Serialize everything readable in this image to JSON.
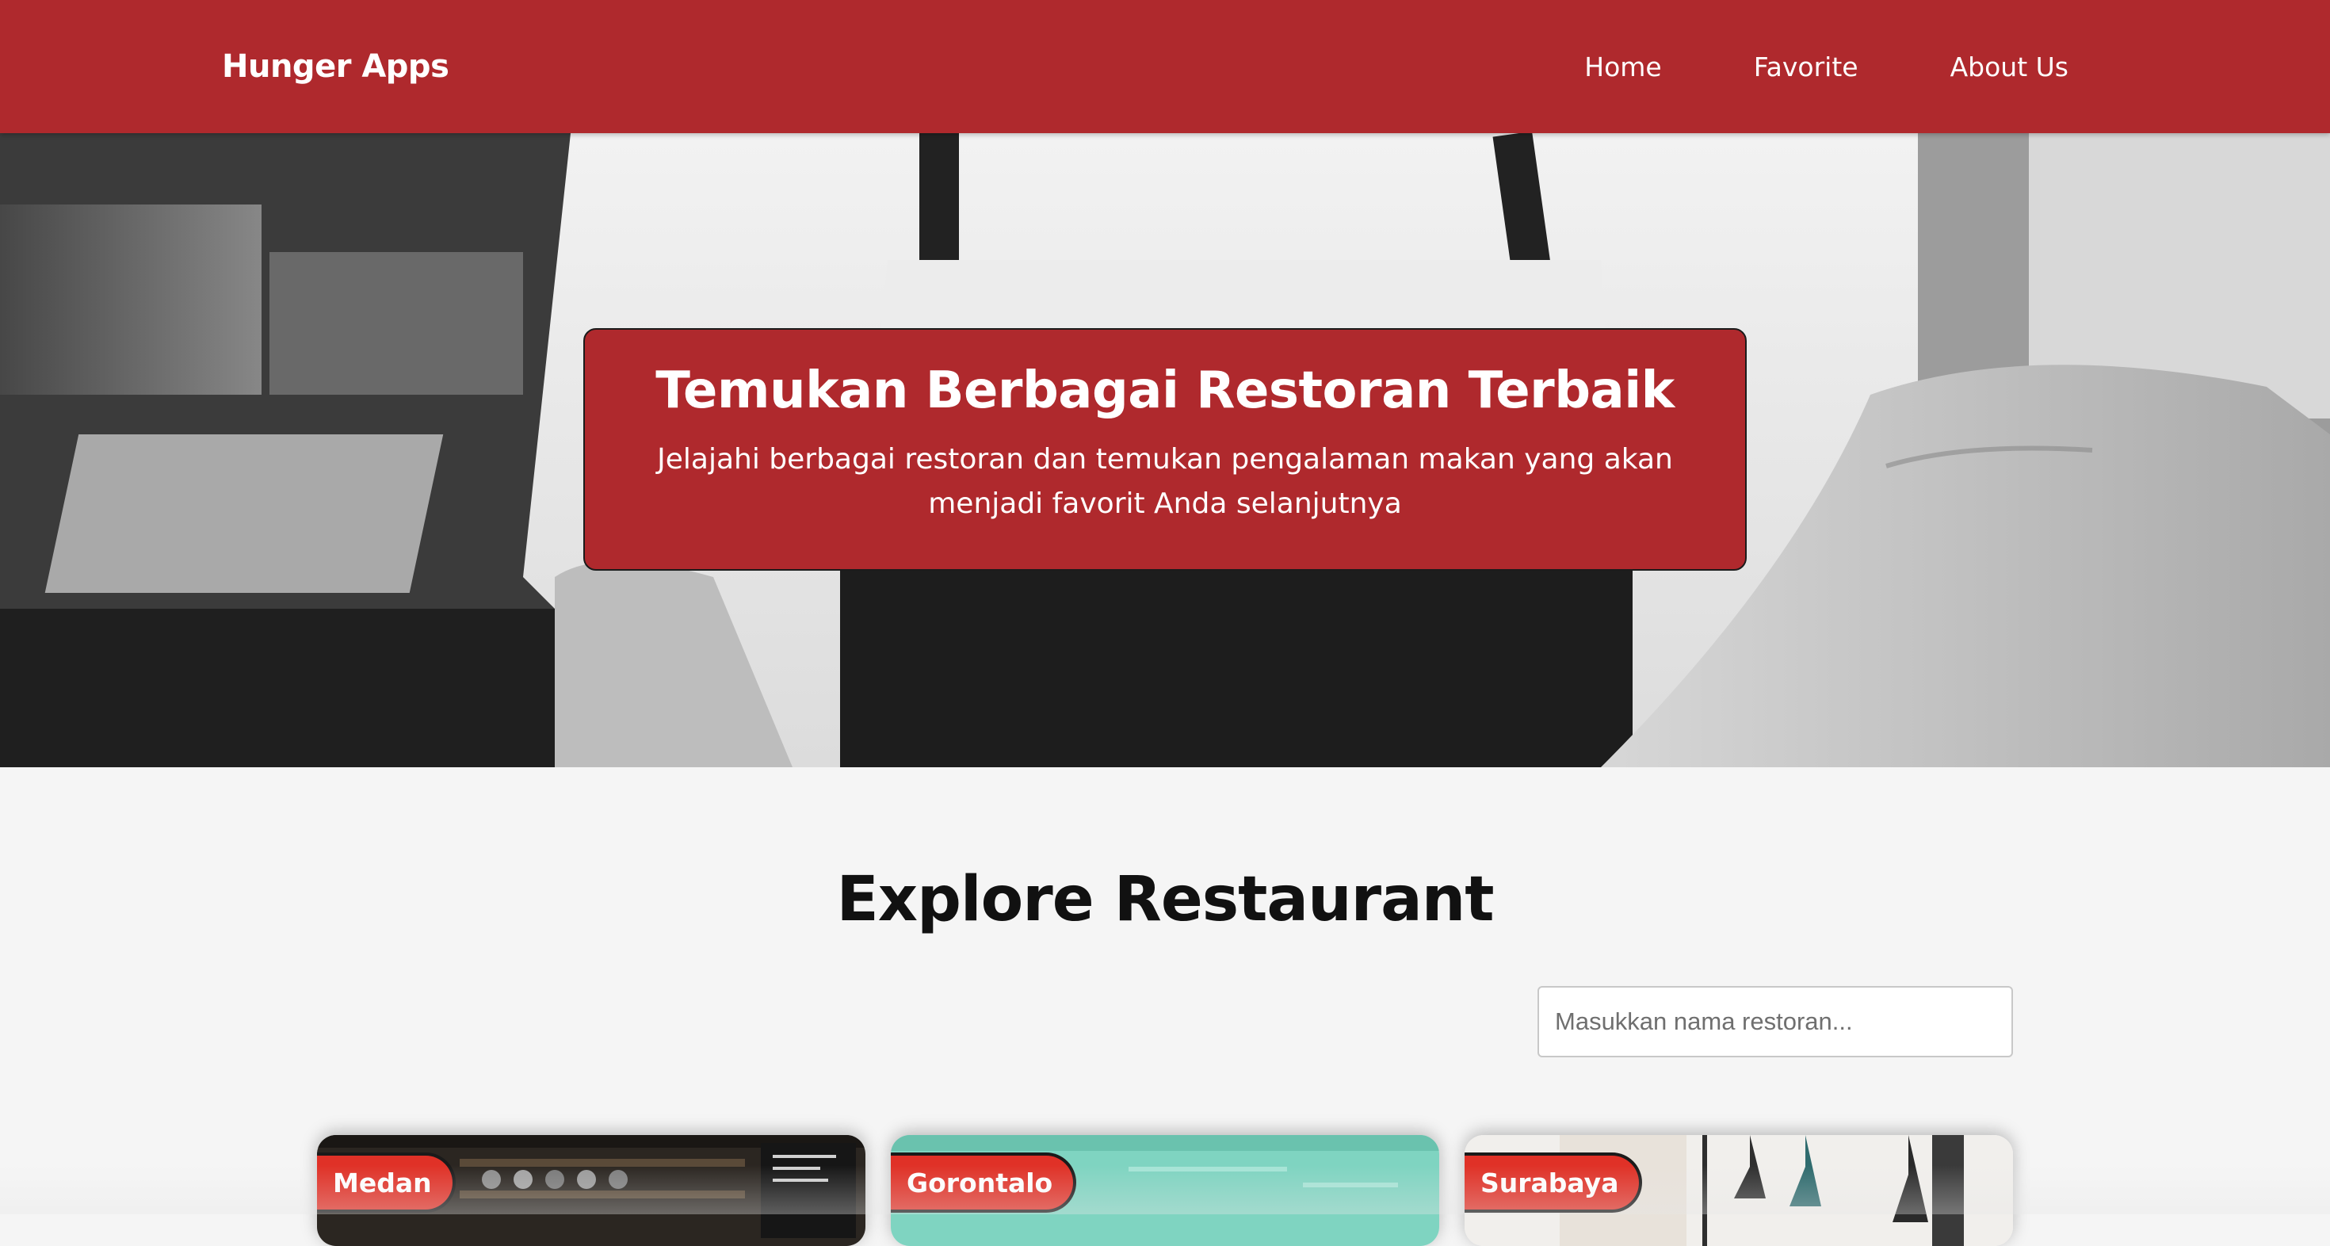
{
  "navbar": {
    "brand": "Hunger Apps",
    "links": [
      {
        "label": "Home"
      },
      {
        "label": "Favorite"
      },
      {
        "label": "About Us"
      }
    ]
  },
  "hero": {
    "title": "Temukan Berbagai Restoran Terbaik",
    "subtitle": "Jelajahi berbagai restoran dan temukan pengalaman makan yang akan menjadi favorit Anda selanjutnya"
  },
  "explore": {
    "title": "Explore Restaurant",
    "search": {
      "placeholder": "Masukkan nama restoran...",
      "value": ""
    }
  },
  "restaurants": [
    {
      "city": "Medan"
    },
    {
      "city": "Gorontalo"
    },
    {
      "city": "Surabaya"
    }
  ],
  "colors": {
    "primary": "#af292d",
    "badge": "#e03127",
    "background": "#f5f5f5"
  }
}
